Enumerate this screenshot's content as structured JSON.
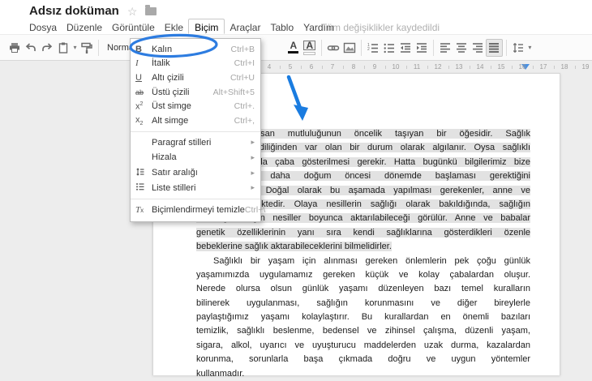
{
  "header": {
    "title": "Adsız doküman",
    "star_icon": "star-icon",
    "folder_icon": "folder-icon",
    "menus": [
      "Dosya",
      "Düzenle",
      "Görüntüle",
      "Ekle",
      "Biçim",
      "Araçlar",
      "Tablo",
      "Yardım"
    ],
    "active_menu_index": 4,
    "save_status": "Tüm değişiklikler kaydedildi"
  },
  "toolbar": {
    "style_selector_value": "Normal m...",
    "left_icons": [
      "print-icon",
      "undo-icon",
      "redo-icon",
      "paste-icon",
      "dropdown-caret-icon",
      "paint-format-icon",
      "separator"
    ],
    "right_icons": [
      "text-color-icon",
      "highlight-color-icon",
      "separator",
      "link-icon",
      "image-icon",
      "separator",
      "numbered-list-icon",
      "bullet-list-icon",
      "outdent-icon",
      "indent-icon",
      "separator",
      "align-left-icon",
      "align-center-icon",
      "align-right-icon",
      "justify-icon",
      "separator",
      "line-spacing-icon",
      "dropdown-caret-icon"
    ],
    "selected_icon": "justify-icon"
  },
  "format_menu": {
    "items": [
      {
        "icon": "bold-icon",
        "label": "Kalın",
        "shortcut": "Ctrl+B",
        "circled": true
      },
      {
        "icon": "italic-icon",
        "label": "İtalik",
        "shortcut": "Ctrl+I"
      },
      {
        "icon": "underline-icon",
        "label": "Altı çizili",
        "shortcut": "Ctrl+U"
      },
      {
        "icon": "strikethrough-icon",
        "label": "Üstü çizili",
        "shortcut": "Alt+Shift+5"
      },
      {
        "icon": "superscript-icon",
        "label": "Üst simge",
        "shortcut": "Ctrl+."
      },
      {
        "icon": "subscript-icon",
        "label": "Alt simge",
        "shortcut": "Ctrl+,"
      },
      {
        "separator": true
      },
      {
        "icon": "",
        "label": "Paragraf stilleri",
        "submenu": true
      },
      {
        "icon": "",
        "label": "Hizala",
        "submenu": true
      },
      {
        "icon": "line-spacing-icon",
        "label": "Satır aralığı",
        "submenu": true
      },
      {
        "icon": "list-styles-icon",
        "label": "Liste stilleri",
        "submenu": true
      },
      {
        "separator": true
      },
      {
        "icon": "clear-formatting-icon",
        "label": "Biçimlendirmeyi temizle",
        "shortcut": "Ctrl+\\"
      }
    ]
  },
  "ruler": {
    "numbers": [
      4,
      5,
      6,
      7,
      8,
      9,
      10,
      11,
      12,
      13,
      14,
      15,
      16,
      17,
      18,
      19
    ],
    "indent_marker_icon": "indent-marker-icon"
  },
  "document": {
    "paragraphs": [
      {
        "selected": true,
        "indent_first_line": true,
        "lines": [
          "Sağlık, insan mutluluğunun öncelik taşıyan bir öğesidir. Sağlık",
          "çoğu kez kendiliğinden var olan bir durum olarak algılanır. Oysa sağlıklı",
          "olmak için fazla çaba gösterilmesi gerekir. Hatta bugünkü bilgilerimiz bize",
          "bu çabaların daha doğum öncesi dönemde başlaması gerektiğini",
          "göstermektedir. Doğal olarak bu aşamada yapılması gerekenler, anne ve",
          "babaya düşmektedir. Olaya nesillerin sağlığı olarak bakıldığında, sağlığın",
          "ve sağlıksızlığın nesiller boyunca aktarılabileceği görülür. Anne ve babalar",
          "genetik özelliklerinin yanı sıra kendi sağlıklarına gösterdikleri özenle",
          "bebeklerine sağlık aktarabileceklerini bilmelidirler."
        ]
      },
      {
        "selected": false,
        "indent_first_line": true,
        "lines": [
          "Sağlıklı bir yaşam için alınması gereken önlemlerin pek çoğu günlük",
          "yaşamımızda uygulamamız gereken küçük ve kolay çabalardan oluşur.",
          "Nerede olursa olsun günlük yaşamı düzenleyen bazı temel kuralların",
          "bilinerek uygulanması, sağlığın korunmasını ve diğer bireylerle",
          "paylaştığımız yaşamı kolaylaştırır. Bu kurallardan en önemli bazıları",
          "temizlik, sağlıklı beslenme, bedensel ve zihinsel çalışma, düzenli yaşam,",
          "sigara, alkol, uyarıcı ve uyuşturucu maddelerden uzak durma, kazalardan",
          "korunma, sorunlarla başa çıkmada doğru ve uygun yöntemler",
          "kullanmadır."
        ]
      }
    ],
    "selection_color": "#e2e2e2"
  },
  "annotations": {
    "circle_color": "#2d7ce0",
    "arrow_color": "#1a7ce0"
  }
}
